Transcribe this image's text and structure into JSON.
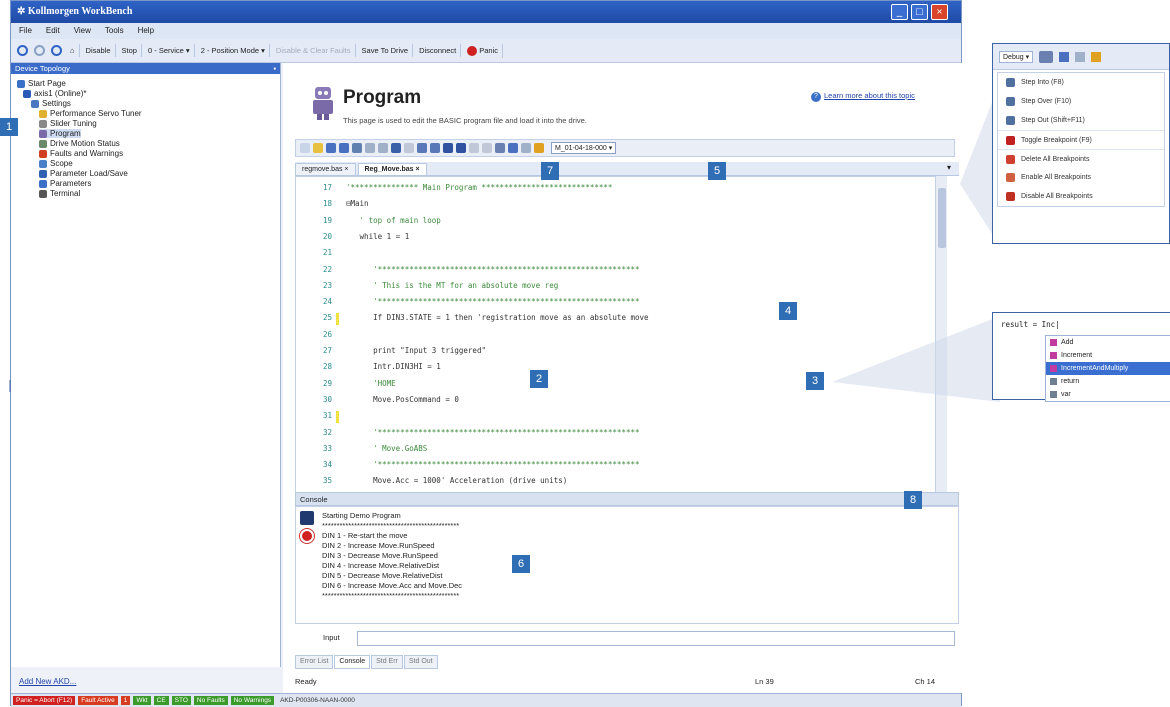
{
  "window": {
    "title": "Kollmorgen WorkBench",
    "min": "_",
    "max": "□",
    "close": "×"
  },
  "menu": [
    "File",
    "Edit",
    "View",
    "Tools",
    "Help"
  ],
  "toolbar": {
    "disable": "Disable",
    "stop": "Stop",
    "service": "0 - Service ▾",
    "position_mode": "2 - Position Mode ▾",
    "disabled_clear": "Disable & Clear Faults",
    "save_to_drive": "Save To Drive",
    "disconnect": "Disconnect",
    "panic": "Panic"
  },
  "tree": {
    "header": "Device Topology",
    "pin": "▪",
    "items": [
      {
        "label": "Start Page",
        "color": "#3a70c8"
      },
      {
        "label": "axis1 (Online)*",
        "color": "#2a5ab8"
      },
      {
        "label": "Settings",
        "color": "#4a78c0"
      },
      {
        "label": "Performance Servo Tuner",
        "color": "#e0b030"
      },
      {
        "label": "Slider Tuning",
        "color": "#888888"
      },
      {
        "label": "Program",
        "color": "#7a6aa8"
      },
      {
        "label": "Drive Motion Status",
        "color": "#6a8a6a"
      },
      {
        "label": "Faults and Warnings",
        "color": "#d04020"
      },
      {
        "label": "Scope",
        "color": "#4a80c8"
      },
      {
        "label": "Parameter Load/Save",
        "color": "#3060b0"
      },
      {
        "label": "Parameters",
        "color": "#3a70c8"
      },
      {
        "label": "Terminal",
        "color": "#555555"
      }
    ],
    "add_new": "Add New AKD..."
  },
  "status": {
    "items": [
      "Panic = Abort (F12)",
      "Fault Active",
      "1",
      "Wkt",
      "CE",
      "STO",
      "No Faults",
      "No Warnings",
      "AKD-P00306-NAAN-0000"
    ],
    "colors": [
      "#d02020",
      "#d83c20",
      "#d83c20",
      "#3a9a2a",
      "#3a9a2a",
      "#3a9a2a",
      "#3a9a2a",
      "#3a9a2a",
      "#dfe6f2"
    ]
  },
  "page": {
    "title": "Program",
    "description": "This page is used to edit the BASIC program file and load it into the drive.",
    "learn_more": "Learn more about this topic",
    "combo_value": "M_01-04-18-000 ▾"
  },
  "tabs": [
    {
      "label": "regmove.bas ×",
      "active": false
    },
    {
      "label": "Reg_Move.bas ×",
      "active": true
    }
  ],
  "editor": {
    "lines": [
      {
        "n": "17",
        "text": "'*************** Main Program *****************************"
      },
      {
        "n": "18",
        "text": "⊟Main"
      },
      {
        "n": "19",
        "text": "   ' top of main loop"
      },
      {
        "n": "20",
        "text": "   while 1 = 1"
      },
      {
        "n": "21",
        "text": ""
      },
      {
        "n": "22",
        "text": "      '**********************************************************"
      },
      {
        "n": "23",
        "text": "      ' This is the MT for an absolute move reg"
      },
      {
        "n": "24",
        "text": "      '**********************************************************"
      },
      {
        "n": "25",
        "text": "      If DIN3.STATE = 1 then 'registration move as an absolute move"
      },
      {
        "n": "26",
        "text": ""
      },
      {
        "n": "27",
        "text": "      print \"Input 3 triggered\""
      },
      {
        "n": "28",
        "text": "      Intr.DIN3HI = 1"
      },
      {
        "n": "29",
        "text": "      'HOME"
      },
      {
        "n": "30",
        "text": "      Move.PosCommand = 0"
      },
      {
        "n": "31",
        "text": ""
      },
      {
        "n": "32",
        "text": "      '**********************************************************"
      },
      {
        "n": "33",
        "text": "      ' Move.GoABS"
      },
      {
        "n": "34",
        "text": "      '**********************************************************"
      },
      {
        "n": "35",
        "text": "      Move.Acc = 1000' Acceleration (drive units)"
      }
    ]
  },
  "console": {
    "header": "Console",
    "lines": [
      "Starting Demo Program",
      "***********************************************",
      "DIN 1 - Re-start the move",
      "DIN 2 - Increase Move.RunSpeed",
      "DIN 3 - Decrease Move.RunSpeed",
      "DIN 4 - Increase Move.RelativeDist",
      "DIN 5 - Decrease Move.RelativeDist",
      "DIN 6 - Increase Move.Acc and Move.Dec",
      "***********************************************"
    ],
    "input_label": "Input",
    "bottom_tabs": [
      {
        "label": "Error List",
        "active": false
      },
      {
        "label": "Console",
        "active": true
      },
      {
        "label": "Std Err",
        "active": false
      },
      {
        "label": "Std Out",
        "active": false
      }
    ],
    "ready": "Ready",
    "ln": "Ln 39",
    "ch": "Ch 14"
  },
  "callouts": [
    "1",
    "2",
    "3",
    "4",
    "5",
    "6",
    "7",
    "8"
  ],
  "debug_menu": {
    "button": "Debug ▾",
    "items": [
      {
        "label": "Step Into (F8)",
        "color": "#5070a0"
      },
      {
        "label": "Step Over (F10)",
        "color": "#5070a0"
      },
      {
        "label": "Step Out (Shift+F11)",
        "color": "#5070a0"
      },
      {
        "label": "Toggle Breakpoint (F9)",
        "color": "#c02020"
      },
      {
        "label": "Delete All Breakpoints",
        "color": "#d04030"
      },
      {
        "label": "Enable All Breakpoints",
        "color": "#d06040"
      },
      {
        "label": "Disable All Breakpoints",
        "color": "#c03020"
      }
    ]
  },
  "autocomplete": {
    "typed": "result = Inc|",
    "items": [
      {
        "label": "Add",
        "selected": false
      },
      {
        "label": "Increment",
        "selected": false
      },
      {
        "label": "IncrementAndMultiply",
        "selected": true
      },
      {
        "label": "return",
        "selected": false
      },
      {
        "label": "var",
        "selected": false
      }
    ]
  }
}
